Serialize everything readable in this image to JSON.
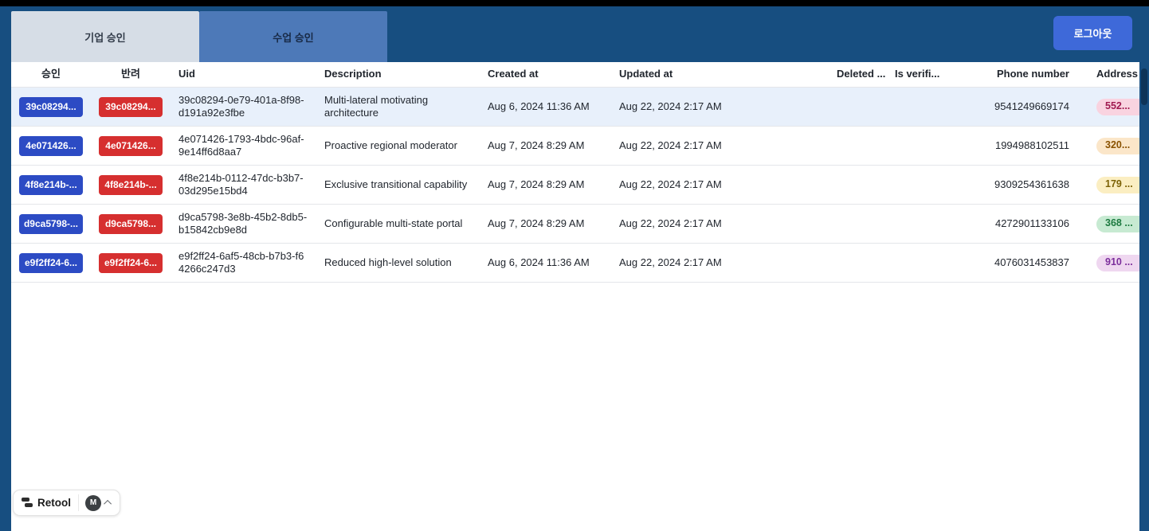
{
  "header": {
    "tabs": [
      {
        "label": "기업 승인",
        "active": true
      },
      {
        "label": "수업 승인",
        "active": false
      }
    ],
    "logout_label": "로그아웃"
  },
  "table": {
    "columns": [
      "승인",
      "반려",
      "Uid",
      "Description",
      "Created at",
      "Updated at",
      "Deleted ...",
      "Is verifi...",
      "Phone number",
      "Address"
    ],
    "rows": [
      {
        "approve_label": "39c08294...",
        "reject_label": "39c08294...",
        "uid": "39c08294-0e79-401a-8f98-d191a92e3fbe",
        "description": "Multi-lateral motivating architecture",
        "created_at": "Aug 6, 2024 11:36 AM",
        "updated_at": "Aug 22, 2024 2:17 AM",
        "deleted_at": "",
        "is_verified": "",
        "phone": "9541249669174",
        "address": "552...",
        "address_tone": "pink",
        "selected": true
      },
      {
        "approve_label": "4e071426...",
        "reject_label": "4e071426...",
        "uid": "4e071426-1793-4bdc-96af-9e14ff6d8aa7",
        "description": "Proactive regional moderator",
        "created_at": "Aug 7, 2024 8:29 AM",
        "updated_at": "Aug 22, 2024 2:17 AM",
        "deleted_at": "",
        "is_verified": "",
        "phone": "1994988102511",
        "address": "320...",
        "address_tone": "orange",
        "selected": false
      },
      {
        "approve_label": "4f8e214b-...",
        "reject_label": "4f8e214b-...",
        "uid": "4f8e214b-0112-47dc-b3b7-03d295e15bd4",
        "description": "Exclusive transitional capability",
        "created_at": "Aug 7, 2024 8:29 AM",
        "updated_at": "Aug 22, 2024 2:17 AM",
        "deleted_at": "",
        "is_verified": "",
        "phone": "9309254361638",
        "address": "179 ...",
        "address_tone": "yellow",
        "selected": false
      },
      {
        "approve_label": "d9ca5798-...",
        "reject_label": "d9ca5798...",
        "uid": "d9ca5798-3e8b-45b2-8db5-b15842cb9e8d",
        "description": "Configurable multi-state portal",
        "created_at": "Aug 7, 2024 8:29 AM",
        "updated_at": "Aug 22, 2024 2:17 AM",
        "deleted_at": "",
        "is_verified": "",
        "phone": "4272901133106",
        "address": "368 ...",
        "address_tone": "green",
        "selected": false
      },
      {
        "approve_label": "e9f2ff24-6...",
        "reject_label": "e9f2ff24-6...",
        "uid": "e9f2ff24-6af5-48cb-b7b3-f64266c247d3",
        "description": "Reduced high-level solution",
        "created_at": "Aug 6, 2024 11:36 AM",
        "updated_at": "Aug 22, 2024 2:17 AM",
        "deleted_at": "",
        "is_verified": "",
        "phone": "4076031453837",
        "address": "910 ...",
        "address_tone": "purple",
        "selected": false
      }
    ]
  },
  "footer": {
    "brand": "Retool",
    "avatar_initial": "M"
  },
  "colors": {
    "navy": "#174E80",
    "tab_active_bg": "#D6DDE6",
    "tab_active_text": "#333C4A",
    "tab_inactive_bg": "#4D79B8",
    "tab_inactive_text": "#182A46",
    "logout_bg": "#3E69D9",
    "approve_bg": "#2C4BC4",
    "reject_bg": "#D62F2F",
    "selected_row_bg": "#E8F0FB",
    "border": "#E4E6EA",
    "header_text": "#1F2430",
    "scroll_thumb": "#0E3458",
    "pill_pink_bg": "#F9D3E0",
    "pill_pink_text": "#A01A50",
    "pill_orange_bg": "#FBE6C9",
    "pill_orange_text": "#8A5200",
    "pill_yellow_bg": "#FBEEC2",
    "pill_yellow_text": "#7C6206",
    "pill_green_bg": "#C7EAD2",
    "pill_green_text": "#1D7A40",
    "pill_purple_bg": "#EFD7F0",
    "pill_purple_text": "#7C2E9C"
  }
}
